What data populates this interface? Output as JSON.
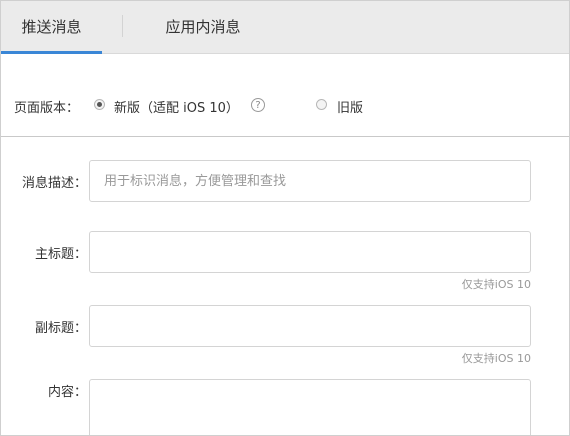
{
  "tabs": [
    {
      "label": "推送消息",
      "active": true
    },
    {
      "label": "应用内消息",
      "active": false
    }
  ],
  "version": {
    "label": "页面版本：",
    "options": [
      {
        "label": "新版（适配 iOS 10）",
        "selected": true
      },
      {
        "label": "旧版",
        "selected": false
      }
    ],
    "help_glyph": "?"
  },
  "form": {
    "description": {
      "label": "消息描述：",
      "placeholder": "用于标识消息，方便管理和查找",
      "value": ""
    },
    "title": {
      "label": "主标题：",
      "value": "",
      "hint": "仅支持iOS 10"
    },
    "subtitle": {
      "label": "副标题：",
      "value": "",
      "hint": "仅支持iOS 10"
    },
    "content": {
      "label": "内容：",
      "value": ""
    }
  },
  "colors": {
    "accent": "#3a86d6",
    "tabbar_bg": "#ebebeb",
    "hint": "#999999"
  },
  "icons": {
    "help": "question-circle-icon"
  }
}
